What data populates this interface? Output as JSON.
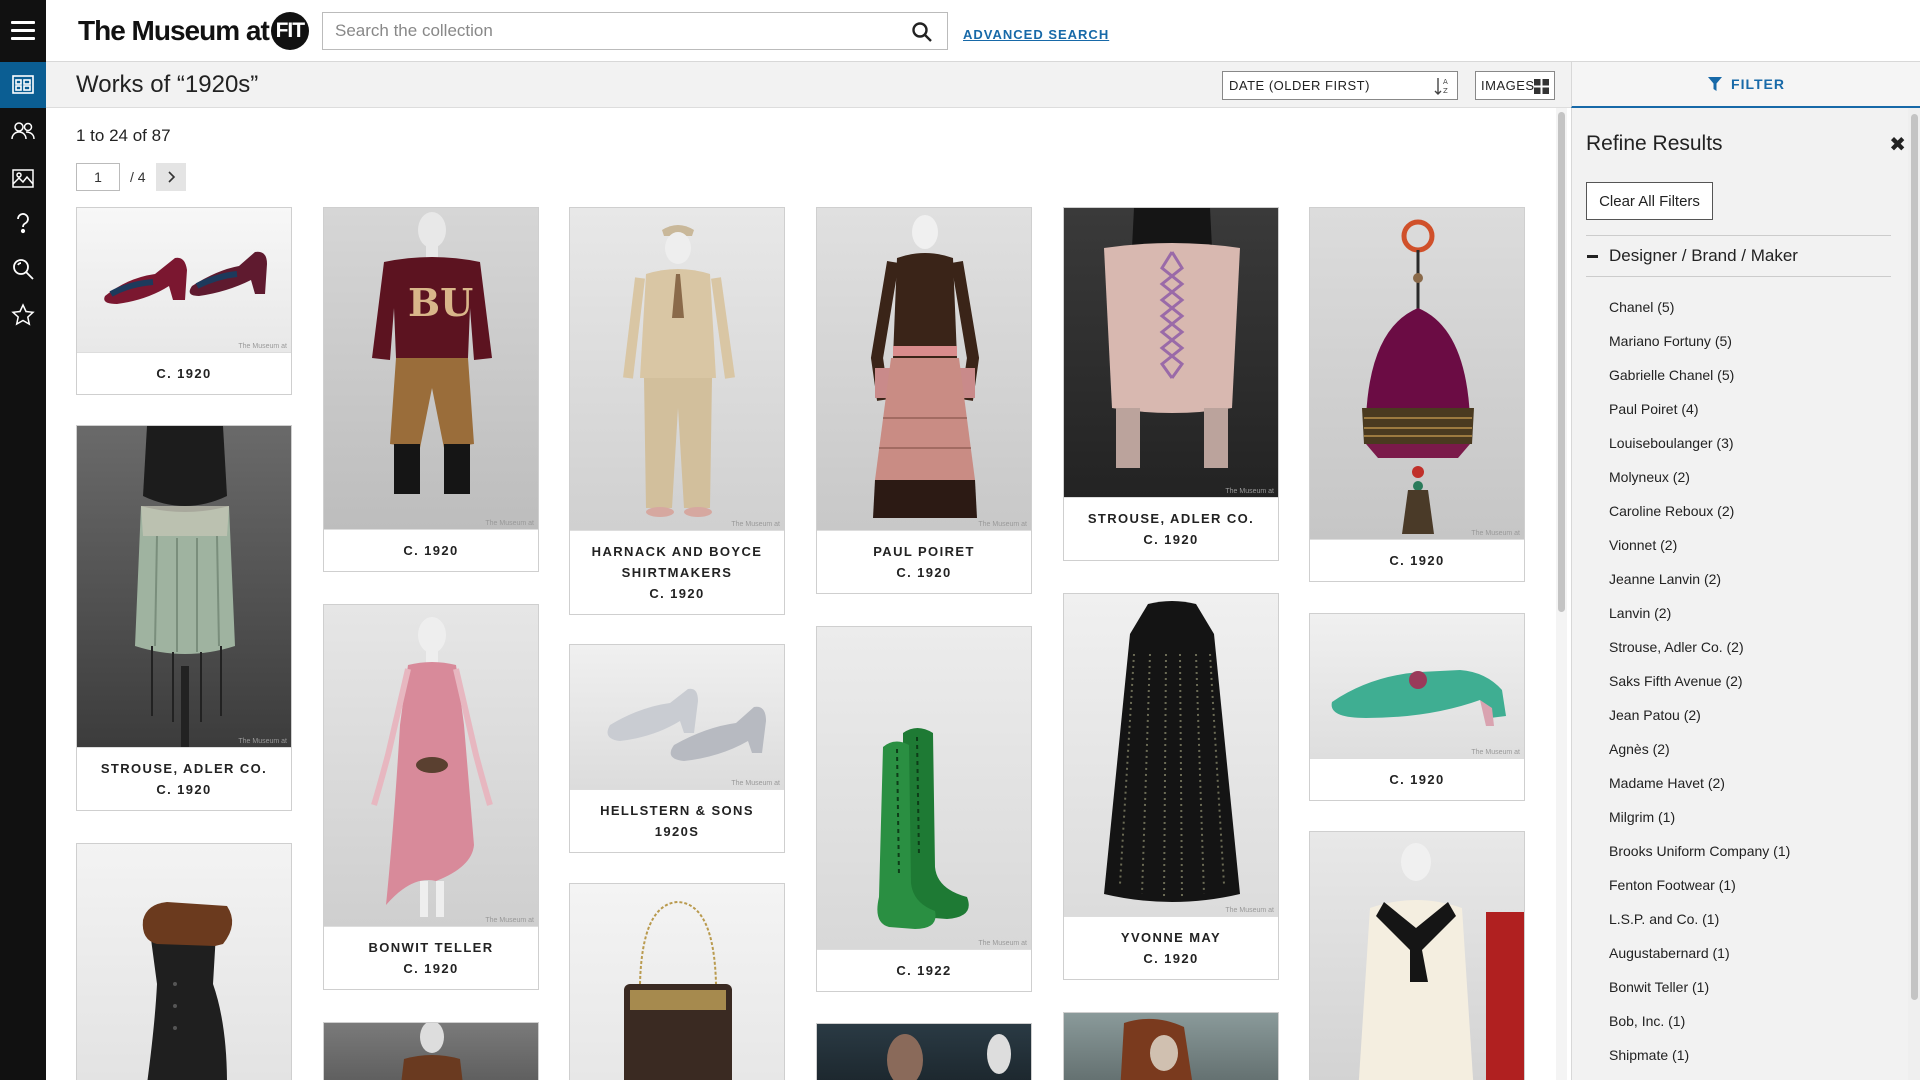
{
  "rail": {
    "icons": [
      "menu-icon",
      "collection-icon",
      "people-icon",
      "exhibitions-icon",
      "help-icon",
      "search-icon",
      "favorites-icon"
    ]
  },
  "header": {
    "logo_text": "The Museum at",
    "logo_badge": "FIT",
    "search_placeholder": "Search the collection",
    "advanced_search": "ADVANCED SEARCH"
  },
  "toolbar": {
    "title": "Works of “1920s”",
    "sort_label": "DATE (OLDER FIRST)",
    "view_label": "IMAGES",
    "filter_label": "FILTER"
  },
  "results": {
    "summary": "1 to 24 of 87",
    "page_value": "1",
    "page_total": "/ 4"
  },
  "items": [
    {
      "maker": "",
      "date": "C. 1920",
      "subject": "shoes"
    },
    {
      "maker": "",
      "date": "C. 1920",
      "subject": "BU sweater and knickers"
    },
    {
      "maker": "HARNACK AND BOYCE SHIRTMAKERS",
      "date": "C. 1920",
      "subject": "suit"
    },
    {
      "maker": "PAUL POIRET",
      "date": "C. 1920",
      "subject": "dress"
    },
    {
      "maker": "STROUSE, ADLER CO.",
      "date": "C. 1920",
      "subject": "corset"
    },
    {
      "maker": "",
      "date": "C. 1920",
      "subject": "bag"
    },
    {
      "maker": "STROUSE, ADLER CO.",
      "date": "C. 1920",
      "subject": "corset"
    },
    {
      "maker": "BONWIT TELLER",
      "date": "C. 1920",
      "subject": "pink dress"
    },
    {
      "maker": "HELLSTERN & SONS",
      "date": "1920S",
      "subject": "silver shoes"
    },
    {
      "maker": "",
      "date": "C. 1922",
      "subject": "green boots"
    },
    {
      "maker": "YVONNE MAY",
      "date": "C. 1920",
      "subject": "coat"
    },
    {
      "maker": "",
      "date": "C. 1920",
      "subject": "green mules"
    }
  ],
  "image_watermark": "The Museum at",
  "filters": {
    "title": "Refine Results",
    "clear_label": "Clear All Filters",
    "section_title": "Designer / Brand / Maker",
    "options": [
      "Chanel (5)",
      "Mariano Fortuny (5)",
      "Gabrielle Chanel (5)",
      "Paul Poiret (4)",
      "Louiseboulanger (3)",
      "Molyneux (2)",
      "Caroline Reboux (2)",
      "Vionnet (2)",
      "Jeanne Lanvin (2)",
      "Lanvin (2)",
      "Strouse, Adler Co. (2)",
      "Saks Fifth Avenue (2)",
      "Jean Patou (2)",
      "Agnès (2)",
      "Madame Havet (2)",
      "Milgrim (1)",
      "Brooks Uniform Company (1)",
      "Fenton Footwear (1)",
      "L.S.P. and Co. (1)",
      "Augustabernard (1)",
      "Bonwit Teller (1)",
      "Bob, Inc. (1)",
      "Shipmate (1)"
    ]
  },
  "colors": {
    "accent": "#1769a8",
    "rail": "#111111",
    "rail_active": "#0b5e93"
  }
}
